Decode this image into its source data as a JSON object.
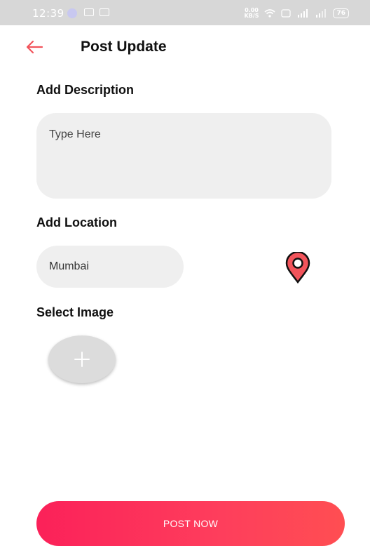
{
  "status_bar": {
    "time": "12:39",
    "net_speed_top": "0.00",
    "net_speed_bottom": "KB/S",
    "battery": "76"
  },
  "header": {
    "title": "Post Update"
  },
  "description": {
    "label": "Add Description",
    "placeholder": "Type Here"
  },
  "location": {
    "label": "Add Location",
    "value": "Mumbai"
  },
  "image": {
    "label": "Select Image"
  },
  "actions": {
    "post_label": "POST NOW"
  },
  "colors": {
    "accent": "#fb2159",
    "pin_fill": "#f2545b",
    "field_bg": "#efefef"
  },
  "icons": {
    "back": "arrow-left-icon",
    "pin": "location-pin-icon",
    "add": "plus-icon"
  }
}
